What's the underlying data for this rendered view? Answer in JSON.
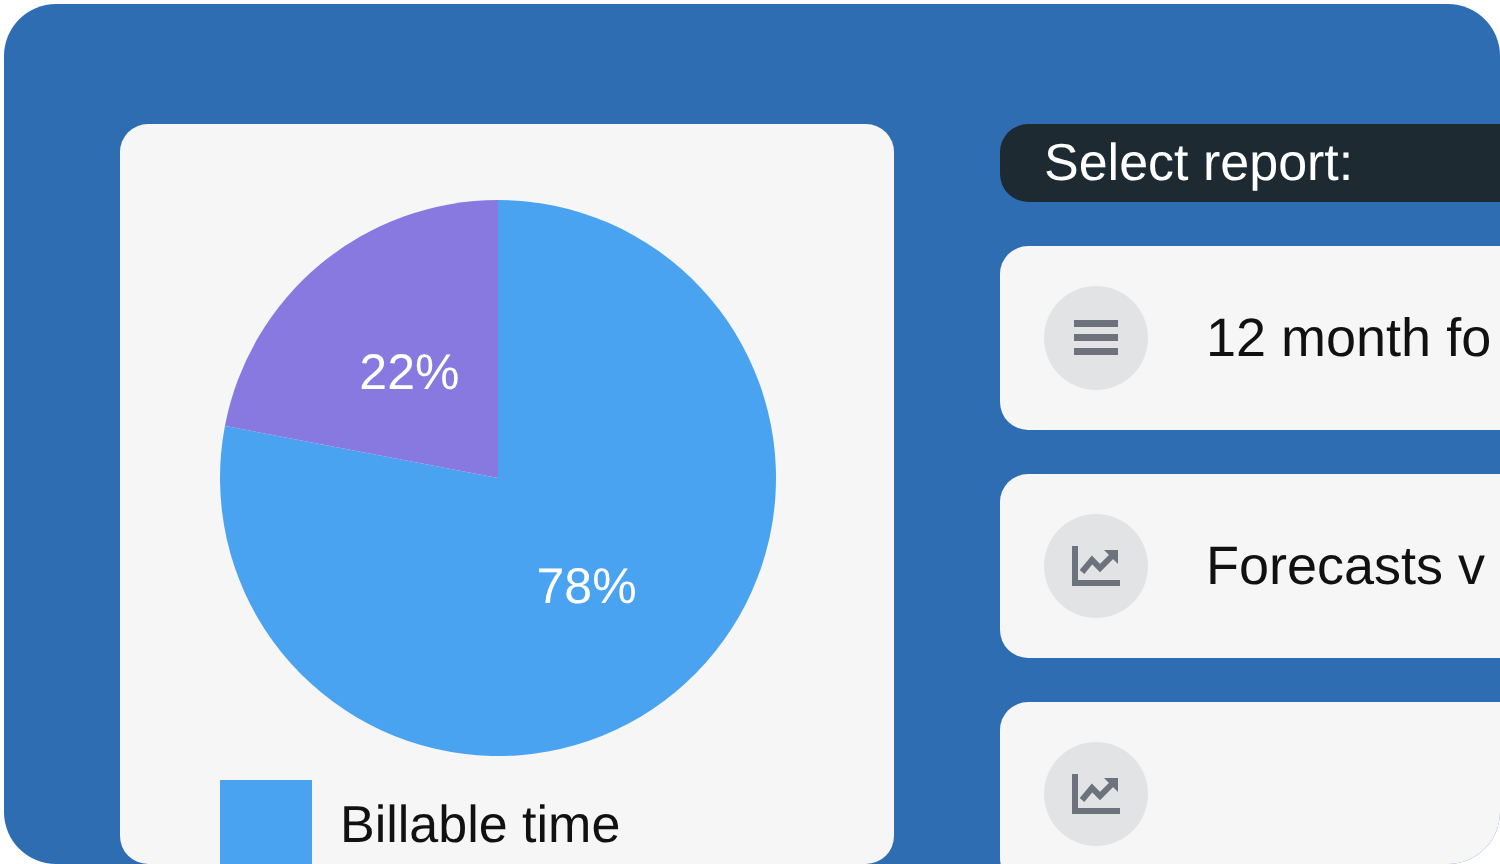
{
  "chart": {
    "chart_data": {
      "type": "pie",
      "values": [
        78,
        22
      ],
      "value_labels": [
        "78%",
        "22%"
      ]
    },
    "legend": [
      {
        "label": "Billable time",
        "color": "#4aa3f0"
      }
    ]
  },
  "report_panel": {
    "title": "Select report:",
    "items": [
      {
        "kind": "list",
        "label": "12 month fo"
      },
      {
        "kind": "chart",
        "label": "Forecasts v"
      },
      {
        "kind": "chart"
      }
    ]
  }
}
